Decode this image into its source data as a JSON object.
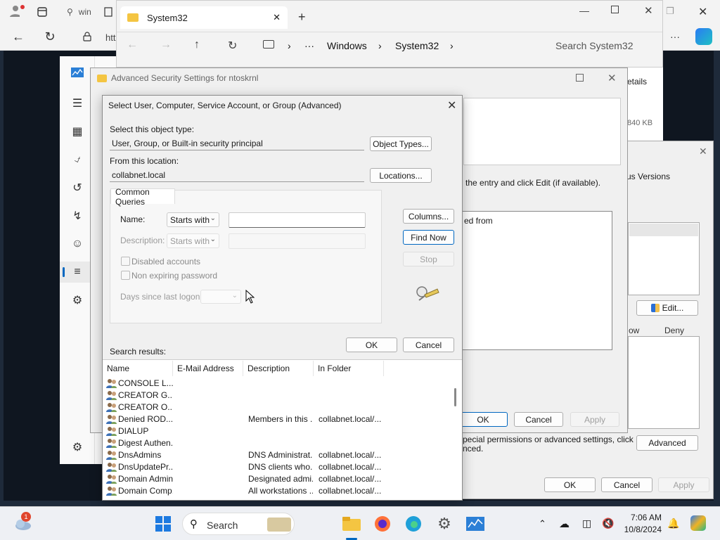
{
  "browser": {
    "tab1_label": "win",
    "address_text": "htt"
  },
  "explorer": {
    "tab_title": "System32",
    "crumbs": [
      "Windows",
      "System32"
    ],
    "search_placeholder": "Search System32",
    "ellipsis": "···"
  },
  "props_window": {
    "details_text": "etails",
    "size_text": "840 KB",
    "tab_label": "us Versions",
    "edit_label": "Edit...",
    "col_allow": "ow",
    "col_deny": "Deny",
    "advanced_label": "Advanced",
    "ok_label": "OK",
    "cancel_label": "Cancel",
    "apply_label": "Apply"
  },
  "adv_window": {
    "title": "Advanced Security Settings for ntoskrnl",
    "instruction": "the entry and click Edit (if available).",
    "inherited_text": "ed from",
    "footer_text_1": "pecial permissions or advanced settings, click",
    "footer_text_2": "nced.",
    "ok_label": "OK",
    "cancel_label": "Cancel",
    "apply_label": "Apply"
  },
  "dialog": {
    "title": "Select User, Computer, Service Account, or Group (Advanced)",
    "object_type_label": "Select this object type:",
    "object_type_value": "User, Group, or Built-in security principal",
    "object_types_btn": "Object Types...",
    "location_label": "From this location:",
    "location_value": "collabnet.local",
    "locations_btn": "Locations...",
    "tab_common": "Common Queries",
    "name_label": "Name:",
    "name_mode": "Starts with",
    "desc_label": "Description:",
    "desc_mode": "Starts with",
    "disabled_accounts": "Disabled accounts",
    "non_expiring": "Non expiring password",
    "days_label": "Days since last logon:",
    "columns_btn": "Columns...",
    "find_now_btn": "Find Now",
    "stop_btn": "Stop",
    "search_results_label": "Search results:",
    "ok_label": "OK",
    "cancel_label": "Cancel",
    "columns": [
      "Name",
      "E-Mail Address",
      "Description",
      "In Folder"
    ],
    "rows": [
      {
        "name": "CONSOLE L...",
        "email": "",
        "desc": "",
        "folder": ""
      },
      {
        "name": "CREATOR G...",
        "email": "",
        "desc": "",
        "folder": ""
      },
      {
        "name": "CREATOR O...",
        "email": "",
        "desc": "",
        "folder": ""
      },
      {
        "name": "Denied ROD...",
        "email": "",
        "desc": "Members in this ...",
        "folder": "collabnet.local/..."
      },
      {
        "name": "DIALUP",
        "email": "",
        "desc": "",
        "folder": ""
      },
      {
        "name": "Digest Authen...",
        "email": "",
        "desc": "",
        "folder": ""
      },
      {
        "name": "DnsAdmins",
        "email": "",
        "desc": "DNS Administrat...",
        "folder": "collabnet.local/..."
      },
      {
        "name": "DnsUpdatePr...",
        "email": "",
        "desc": "DNS clients who...",
        "folder": "collabnet.local/..."
      },
      {
        "name": "Domain Admins",
        "email": "",
        "desc": "Designated admi...",
        "folder": "collabnet.local/..."
      },
      {
        "name": "Domain Comp...",
        "email": "",
        "desc": "All workstations ...",
        "folder": "collabnet.local/..."
      }
    ]
  },
  "taskbar": {
    "search_label": "Search",
    "time": "7:06 AM",
    "date": "10/8/2024",
    "weather_badge": "1"
  }
}
